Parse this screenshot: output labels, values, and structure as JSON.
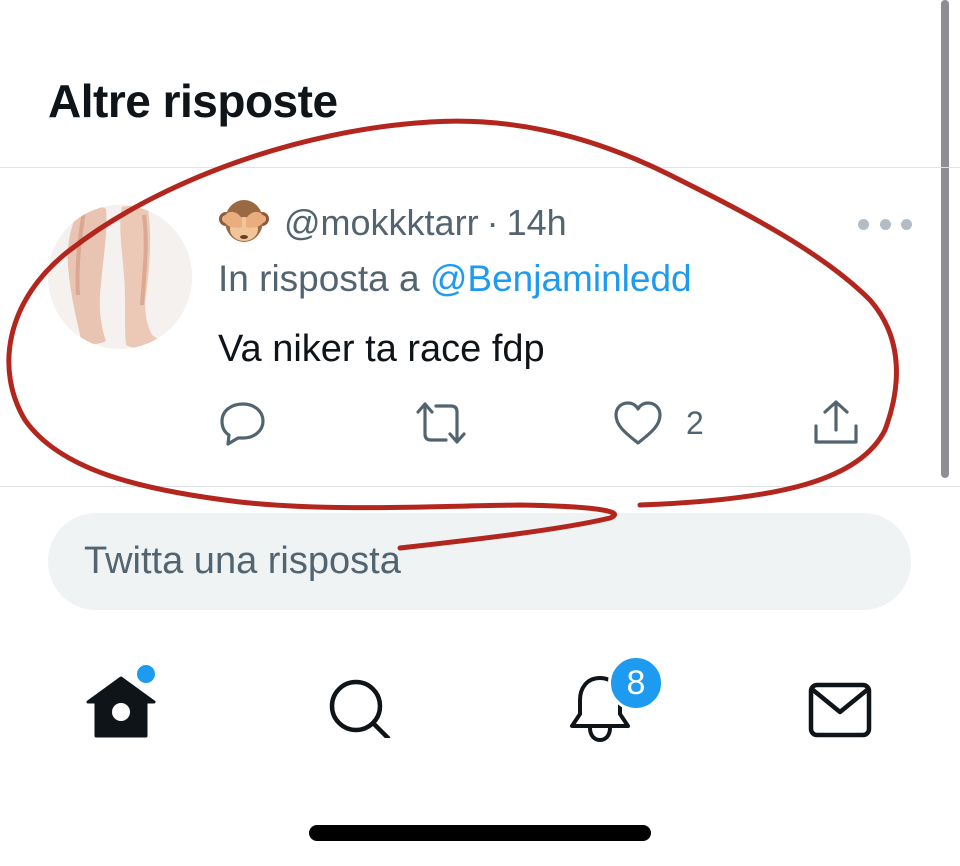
{
  "section": {
    "title": "Altre risposte"
  },
  "tweet": {
    "handle": "@mokkktarr",
    "separator": "·",
    "time": "14h",
    "reply_prefix": "In risposta a",
    "reply_to": "@Benjaminledd",
    "text": "Va niker ta race fdp",
    "likes": "2",
    "emoji_icon": "see-no-evil-monkey-icon"
  },
  "composer": {
    "placeholder": "Twitta una risposta"
  },
  "bottom_nav": {
    "items": [
      "home-icon",
      "search-icon",
      "notifications-icon",
      "messages-icon"
    ],
    "notifications_badge": "8"
  },
  "colors": {
    "accent": "#1d9bf0",
    "secondary_text": "#536471",
    "annotation_stroke": "#b3261e"
  }
}
